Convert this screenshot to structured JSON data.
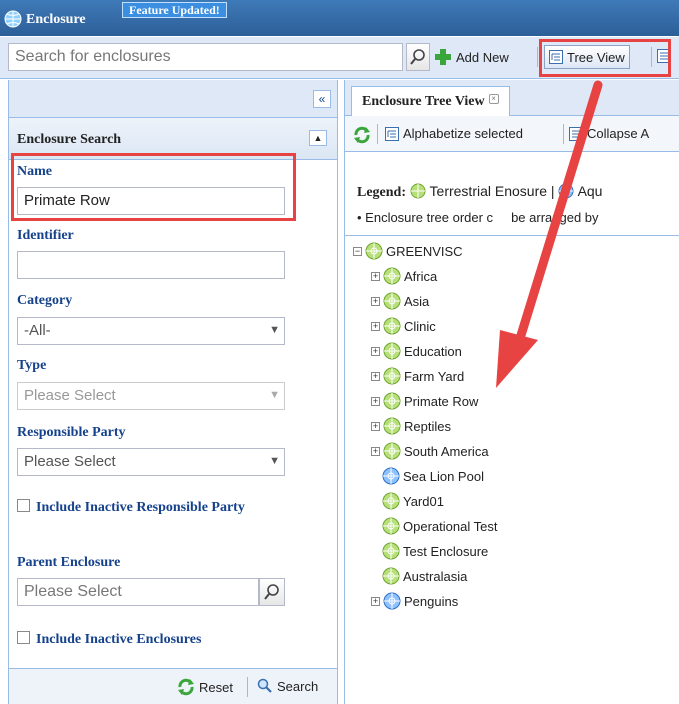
{
  "app": {
    "title": "Enclosure",
    "badge": "Feature Updated!"
  },
  "toolbar": {
    "search_placeholder": "Search for enclosures",
    "add_new": "Add New",
    "tree_view": "Tree View"
  },
  "left_panel": {
    "header": "Enclosure Search",
    "fields": {
      "name_label": "Name",
      "name_value": "Primate Row",
      "identifier_label": "Identifier",
      "identifier_value": "",
      "category_label": "Category",
      "category_value": "-All-",
      "type_label": "Type",
      "type_value": "Please Select",
      "responsible_label": "Responsible Party",
      "responsible_value": "Please Select",
      "include_inactive_responsible": "Include Inactive Responsible Party",
      "parent_label": "Parent Enclosure",
      "parent_value": "Please Select",
      "include_inactive_enclosures": "Include Inactive Enclosures"
    },
    "reset": "Reset",
    "search": "Search"
  },
  "right_panel": {
    "tab": "Enclosure Tree View",
    "alphabetize": "Alphabetize selected",
    "collapse": "Collapse A",
    "legend_label": "Legend:",
    "legend_terrestrial": "Terrestrial En",
    "legend_terrestrial_end": "osure |",
    "legend_aquatic": "Aqu",
    "note_start": "• Enclosure tree order c",
    "note_end": "be arranged by",
    "tree": {
      "root": "GREENVISC",
      "children": [
        {
          "label": "Africa",
          "expandable": true,
          "type": "terrestrial"
        },
        {
          "label": "Asia",
          "expandable": true,
          "type": "terrestrial"
        },
        {
          "label": "Clinic",
          "expandable": true,
          "type": "terrestrial"
        },
        {
          "label": "Education",
          "expandable": true,
          "type": "terrestrial"
        },
        {
          "label": "Farm Yard",
          "expandable": true,
          "type": "terrestrial"
        },
        {
          "label": "Primate Row",
          "expandable": true,
          "type": "terrestrial"
        },
        {
          "label": "Reptiles",
          "expandable": true,
          "type": "terrestrial"
        },
        {
          "label": "South America",
          "expandable": true,
          "type": "terrestrial"
        },
        {
          "label": "Sea Lion Pool",
          "expandable": false,
          "type": "aquatic"
        },
        {
          "label": "Yard01",
          "expandable": false,
          "type": "terrestrial"
        },
        {
          "label": "Operational Test",
          "expandable": false,
          "type": "terrestrial"
        },
        {
          "label": "Test Enclosure",
          "expandable": false,
          "type": "terrestrial"
        },
        {
          "label": "Australasia",
          "expandable": false,
          "type": "terrestrial"
        },
        {
          "label": "Penguins",
          "expandable": true,
          "type": "aquatic"
        }
      ]
    }
  },
  "colors": {
    "accent": "#15428b",
    "highlight": "#e84343",
    "terrestrial": "#8cc63f",
    "aquatic": "#3b7fd6"
  }
}
